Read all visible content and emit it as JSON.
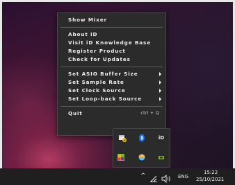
{
  "menu": {
    "show_mixer": "Show Mixer",
    "about": "About iD",
    "visit_kb": "Visit iD Knowledge Base",
    "register": "Register Product",
    "check_updates": "Check for Updates",
    "asio_buffer": "Set ASIO Buffer Size",
    "sample_rate": "Set Sample Rate",
    "clock_source": "Set Clock Source",
    "loopback_source": "Set Loop-back Source",
    "quit": "Quit",
    "quit_shortcut": "ctrl + Q"
  },
  "tray": {
    "id_label": "iD",
    "icons": [
      "security-icon",
      "bluetooth-icon",
      "id-app-icon",
      "colorful-app-icon",
      "color-sphere-icon",
      "nvidia-icon"
    ]
  },
  "taskbar": {
    "language": "ENG",
    "time": "15:22",
    "date": "25/10/2021",
    "icons": [
      "chevron-up-icon",
      "network-icon",
      "volume-icon"
    ]
  }
}
